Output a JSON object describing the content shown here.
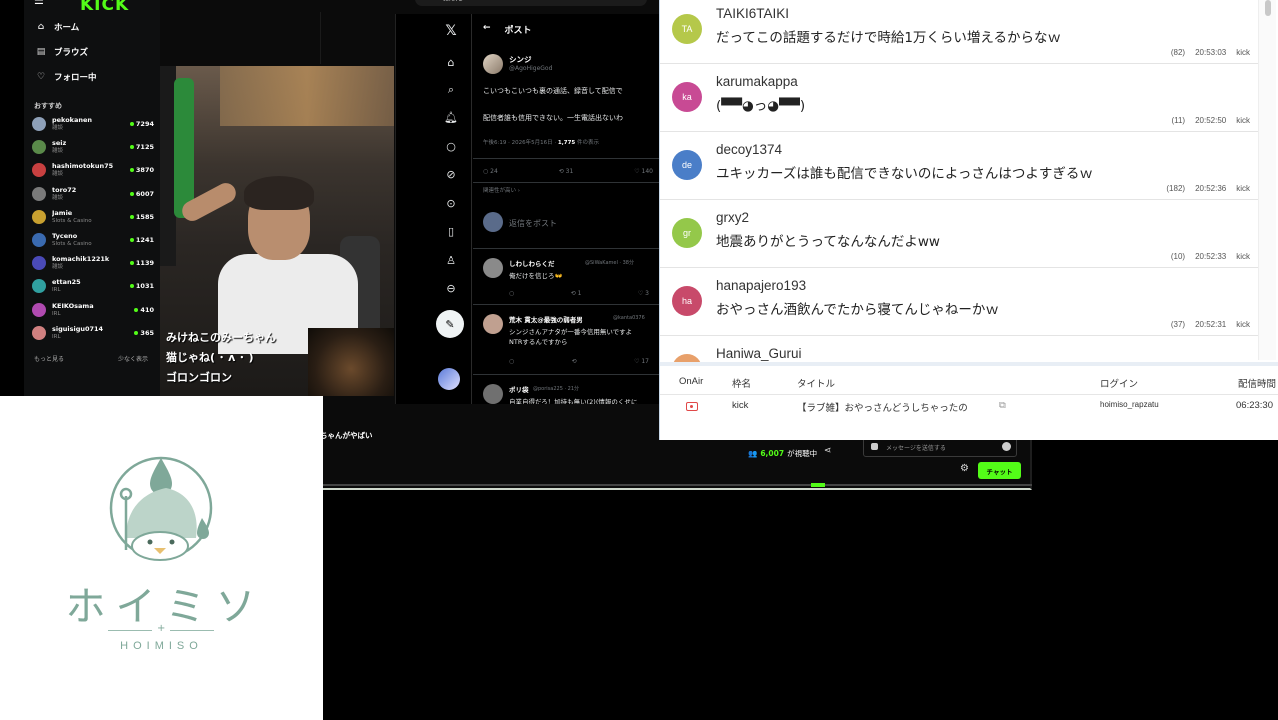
{
  "kick": {
    "logo": "KICK",
    "nav": [
      {
        "icon": "home-icon",
        "glyph": "⌂",
        "label": "ホーム"
      },
      {
        "icon": "browse-icon",
        "glyph": "▤",
        "label": "ブラウズ"
      },
      {
        "icon": "heart-icon",
        "glyph": "♡",
        "label": "フォロー中"
      }
    ],
    "recommended_label": "おすすめ",
    "channels": [
      {
        "name": "pekokanen",
        "category": "雑談",
        "viewers": "7294",
        "color": "#8ea0b8"
      },
      {
        "name": "seiz",
        "category": "雑談",
        "viewers": "7125",
        "color": "#5a8a4a"
      },
      {
        "name": "hashimotokun75",
        "category": "雑談",
        "viewers": "3870",
        "color": "#c84040"
      },
      {
        "name": "toro72",
        "category": "雑談",
        "viewers": "6007",
        "color": "#7a7a7a"
      },
      {
        "name": "Jamie",
        "category": "Slots & Casino",
        "viewers": "1585",
        "color": "#c8a030"
      },
      {
        "name": "Tyceno",
        "category": "Slots & Casino",
        "viewers": "1241",
        "color": "#3a6ab0"
      },
      {
        "name": "komachik1221k",
        "category": "雑談",
        "viewers": "1139",
        "color": "#4a4ab8"
      },
      {
        "name": "ettan25",
        "category": "IRL",
        "viewers": "1031",
        "color": "#30a0a0"
      },
      {
        "name": "KEIKOsama",
        "category": "IRL",
        "viewers": "410",
        "color": "#b04ab0"
      },
      {
        "name": "siguisigu0714",
        "category": "IRL",
        "viewers": "365",
        "color": "#d08080"
      }
    ],
    "show_more": "もっと見る",
    "show_less": "少なく表示",
    "overlay_lines": [
      "みけねこのみーちゃん",
      "猫じゃね( ･ ᴧ ･ )",
      "ゴロンゴロン"
    ],
    "stream_title": "ちゃんがやばい",
    "viewer_count": "6,007",
    "viewer_suffix": "が視聴中",
    "chat_placeholder": "メッセージを送信する",
    "chat_button": "チャット",
    "progress_fraction": 0.69
  },
  "x": {
    "search_value": "toro72",
    "header_title": "ポスト",
    "post": {
      "name": "シンジ",
      "handle": "@AgoHigeGod",
      "line1": "こいつもこいつも裏の通話、録音して配信で",
      "line2": "配信者誰も信用できない。一生電話出ないわ",
      "time": "午後6:19 · 2026年5月16日 · ",
      "views": "1,775",
      "views_suffix": " 件の表示",
      "replies": "24",
      "reposts": "31",
      "likes": "140",
      "related": "関連性が高い ›"
    },
    "reply_placeholder": "返信をポスト",
    "replies": [
      {
        "name": "しわしわらくだ",
        "handle": "@SiWaKamel · 38分",
        "text": "俺だけを信じろ👐",
        "color": "#8a8a8a"
      },
      {
        "name": "荒木 貫太@最強の弱者男",
        "handle": "@kanta0376",
        "text": "シンジさんアナタが一番今信用無いですよ",
        "text2": "NTRするんですから",
        "color": "#c0a090"
      },
      {
        "name": "ポリ袋",
        "handle": "@porisa225 · 21分",
        "text": "自業自得だろ！加持も無い(2)(情報のくせに",
        "color": "#707070"
      }
    ]
  },
  "comments": [
    {
      "user": "TAIKI6TAIKI",
      "initials": "TA",
      "color": "#b5c84a",
      "message": "だってこの話題するだけで時給1万くらい増えるからなｗ",
      "count": "(82)",
      "time": "20:53:03",
      "platform": "kick"
    },
    {
      "user": "karumakappa",
      "initials": "ka",
      "color": "#c84a94",
      "message": "(▀▀◕っ◕▀▀)",
      "count": "(11)",
      "time": "20:52:50",
      "platform": "kick"
    },
    {
      "user": "decoy1374",
      "initials": "de",
      "color": "#4a7ec8",
      "message": "ユキッカーズは誰も配信できないのによっさんはつよすぎるｗ",
      "count": "(182)",
      "time": "20:52:36",
      "platform": "kick"
    },
    {
      "user": "grxy2",
      "initials": "gr",
      "color": "#94c84a",
      "message": "地震ありがとうってなんなんだよww",
      "count": "(10)",
      "time": "20:52:33",
      "platform": "kick"
    },
    {
      "user": "hanapajero193",
      "initials": "ha",
      "color": "#c84a6a",
      "message": "おやっさん酒飲んでたから寝てんじゃねーかｗ",
      "count": "(37)",
      "time": "20:52:31",
      "platform": "kick"
    },
    {
      "user": "Haniwa_Gurui",
      "initials": "Ha",
      "color": "#e8a06a",
      "message": "",
      "count": "",
      "time": "",
      "platform": ""
    }
  ],
  "table": {
    "headers": [
      "OnAir",
      "枠名",
      "タイトル",
      "ログイン",
      "配信時間"
    ],
    "row": {
      "frame": "kick",
      "title": "【ラブ雑】おやっさんどうしちゃったの",
      "login": "hoimiso_rapzatu",
      "duration": "06:23:30"
    }
  },
  "logo": {
    "jp": "ホイミソ",
    "en": "HOIMISO",
    "color": "#7fa899"
  }
}
